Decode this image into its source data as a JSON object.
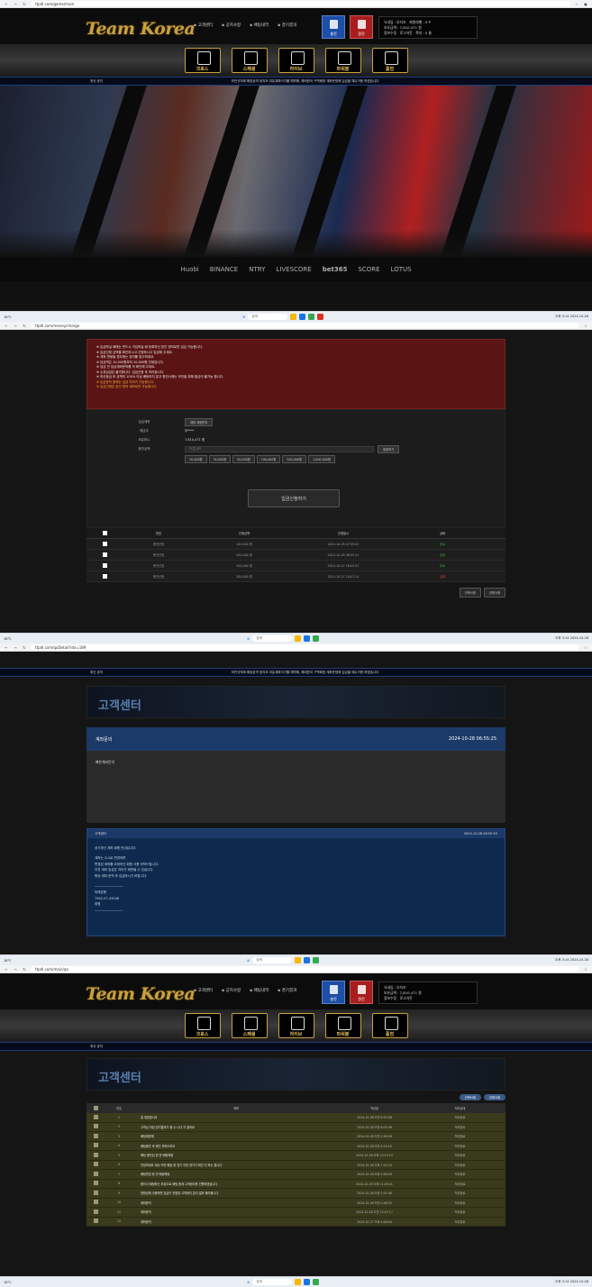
{
  "browser": {
    "p1_url": "ttpdl.com/game/main",
    "p2_url": "ttpdl.com/money/charge",
    "p3_url": "ttpdl.com/qaDetail?idx=189",
    "p4_url": "ttpdl.com/main/qa"
  },
  "taskbar": {
    "weather": "18°C",
    "weather2": "흐림",
    "search": "검색",
    "time": "오후 3:14",
    "date": "2024-10-28",
    "lang": "A"
  },
  "site": {
    "logo": "Team Korea",
    "nav": [
      "고객센터",
      "공지사항",
      "배팅내역",
      "경기결과"
    ],
    "deposit": "충전",
    "withdraw": "환전",
    "user": {
      "l1": "닉네임 : 부자조",
      "l1b": "회원레벨 : 0 P",
      "l2": "보유금액 : 7,810,471 원",
      "l3": "포인트 : 0 P",
      "l3a": "쪽지 : 0 통",
      "l4": "정보수정",
      "l4a": "로그아웃"
    }
  },
  "games": [
    "크로스",
    "스페셜",
    "라이브",
    "파워볼",
    "홀덤"
  ],
  "games_sub": "POWER",
  "notice": {
    "label": "최신 공지",
    "text": "보안규칙에 해킹공격 정지조 여유계좌이기를 예약해, 해외한국 구역배정 계좌운영에 입금을 예수거용 하였습니다"
  },
  "partners": [
    "bet365",
    "Huobi",
    "BINANCE",
    "NTRY",
    "LIVESCORE",
    "bet365",
    "SCORE",
    "LOTUS"
  ],
  "charge": {
    "alerts": [
      "※ 입금하실 때에는 반드시 가입하실 때 등록하신 본인 명의로만 입금 가능합니다.",
      "※ 입금신청 금액을 확인하시고 신청하시고 입금해 주세요.",
      "※ 계좌 변동될 경우에는 공지를 참고하세요.",
      "※ 입금액은 10,000원부터 10,000원 단위입니다.",
      "※ 입금 전 입금계좌문의를 꼭 확인해 주세요.",
      "※ 수표입금은 불가합니다. 입금신청 후 처리됩니다.",
      "※ 최신등급 후 금액의 100% 이상 배팅하지 않고 환전시에는 보안을 위해 출금이 불가능 합니다."
    ],
    "alerts_y": [
      "※ 입금문의 중에는 입금 처리가 가능합니다.",
      "※ 입금신청은 본인 명의 계좌로만 가능합니다."
    ],
    "rows": [
      {
        "label": "입금계좌",
        "value": "계좌 계정문의"
      },
      {
        "label": "예금주",
        "value": "부****"
      },
      {
        "label": "보유머니",
        "value": "7,810,471 원"
      },
      {
        "label": "충전금액",
        "value": "직접입력"
      }
    ],
    "reset": "정정하기",
    "amounts": [
      "10,000원",
      "30,000원",
      "50,000원",
      "100,000원",
      "500,000원",
      "1,000,000원"
    ],
    "submit": "입금신청하기",
    "cols": [
      "번호",
      "신청금액",
      "신청일시",
      "상태"
    ],
    "data": [
      [
        "충전신청",
        "100,000 원",
        "2024-10-28 07:55:02",
        "완료"
      ],
      [
        "충전신청",
        "450,000 원",
        "2024-10-28 08:55:22",
        "완료"
      ],
      [
        "충전신청",
        "300,000 원",
        "2024-10-27 18:02:47",
        "완료"
      ],
      [
        "충전신청",
        "300,000 원",
        "2024-10-27 18:07:14",
        "실패"
      ]
    ],
    "btn_sel": "선택삭제",
    "btn_all": "전체삭제"
  },
  "cs": {
    "title": "고객센터",
    "inq_title": "계좌문의",
    "inq_date": "2024-10-28 06:55:25",
    "inq_body": "빠른계좌문의",
    "reply_from": "고객센터",
    "reply_date": "2024-10-28 06:55:53",
    "reply": [
      "상기하신 계좌 회원 안내입니다.",
      "계좌는 수시로 변경되며",
      "변경된 계좌를 요청하신 회원 사용 부탁드립니다.",
      "이전 계좌 입금은 처리가 제한될 수 있습니다.",
      "항상 계좌 문의 후 입금하시기 바랍니다.",
      "—————————",
      "미래은행",
      "7942-07-43048",
      "위원",
      "—————————"
    ]
  },
  "qa": {
    "btn_write": "선택삭제",
    "btn_all": "전체삭제",
    "cols": [
      "번호",
      "제목",
      "작성일",
      "처리상태"
    ],
    "list": [
      [
        "1",
        "일 정정필니다",
        "2024-10-28 오전 6:55:06",
        "처리완료"
      ],
      [
        "2",
        "고객님 여된 경기결과가 볼 수 니다 각 결과로",
        "2024-10-28 오전 6:02:46",
        "처리완료"
      ],
      [
        "3",
        "배팅제한해",
        "2024-10-28 오전 4:56:58",
        "처리완료"
      ],
      [
        "4",
        "배팅중단 후 확인 부탁드려요",
        "2024-10-28 오전 4:25:10",
        "처리완료"
      ],
      [
        "5",
        "배팅 중단된 한 번 배팅해줘",
        "2024-10-28 오후 10:15:15",
        "처리완료"
      ],
      [
        "6",
        "안녕하세요 계사 어떤 배팅 한 경기 이런 경기가 확인 다 하는 필니다",
        "2024-10-26 오후 7:44:19",
        "처리완료"
      ],
      [
        "7",
        "배팅변경 한 번 배팅해줘",
        "2024-10-26 오후 3:48:09",
        "처리완료"
      ],
      [
        "8",
        "합치서 배팅하는 부분으로 배팅 중계 고객센터를 진행하겠습니다",
        "2024-10-26 오후 11:05:41",
        "처리완료"
      ],
      [
        "9",
        "한합성에 사용하면 입금이 전환된 고객센터 분리 결과 불러움니다",
        "2024-10-26 오전 1:01:46",
        "처리완료"
      ],
      [
        "10",
        "계좌문의",
        "2024-10-26 오전 0:48:55",
        "처리완료"
      ],
      [
        "11",
        "계좌문의",
        "2024-10-28 오전 12:47:17",
        "처리완료"
      ],
      [
        "12",
        "계좌문의",
        "2024-10-27 오후 4:08:04",
        "처리완료"
      ]
    ],
    "btn_bottom": "글쓰기"
  }
}
